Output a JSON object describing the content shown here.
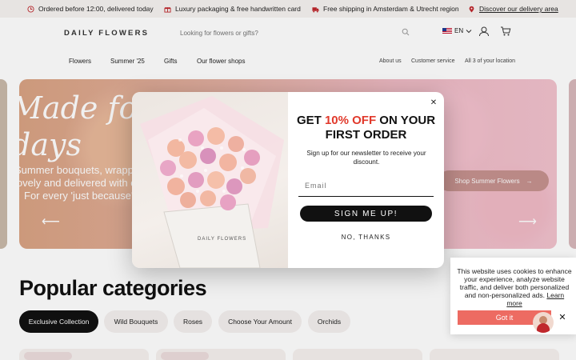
{
  "usp_bar": {
    "items": [
      {
        "icon": "clock-icon",
        "text": "Ordered before 12:00, delivered today"
      },
      {
        "icon": "gift-icon",
        "text": "Luxury packaging & free handwritten card"
      },
      {
        "icon": "truck-icon",
        "text": "Free shipping in Amsterdam & Utrecht region"
      },
      {
        "icon": "location-pin-icon",
        "text": "Discover our delivery area"
      }
    ]
  },
  "header": {
    "logo": "DAILY FLOWERS",
    "search_placeholder": "Looking for flowers or gifts?",
    "language": "EN"
  },
  "nav": {
    "left": [
      "Flowers",
      "Summer '25",
      "Gifts",
      "Our flower shops"
    ],
    "right": [
      "About us",
      "Customer service",
      "All 3 of your location"
    ]
  },
  "hero": {
    "title_line1": "Made for",
    "title_line2": "days",
    "subtitle_line1": "Summer bouquets, wrapped",
    "subtitle_line2": "lovely and delivered with care",
    "subtitle_line3": "For every 'just because'",
    "cta": "Shop Summer Flowers"
  },
  "popup": {
    "headline_pre": "GET ",
    "headline_accent": "10% OFF",
    "headline_post": " ON YOUR FIRST ORDER",
    "body": "Sign up for our newsletter to receive your discount.",
    "email_placeholder": "Email",
    "submit": "SIGN ME UP!",
    "decline": "NO, THANKS",
    "close": "✕",
    "bag_label": "DAILY FLOWERS",
    "accent_color": "#e1392b"
  },
  "categories": {
    "title": "Popular categories",
    "pills": [
      "Exclusive Collection",
      "Wild Bouquets",
      "Roses",
      "Choose Your Amount",
      "Orchids"
    ]
  },
  "cookie": {
    "text": "This website uses cookies to enhance your experience, analyze website traffic, and deliver both personalized and non-personalized ads.",
    "learn_more": "Learn more",
    "button": "Got it",
    "close": "✕",
    "button_color": "#ed6b62"
  }
}
